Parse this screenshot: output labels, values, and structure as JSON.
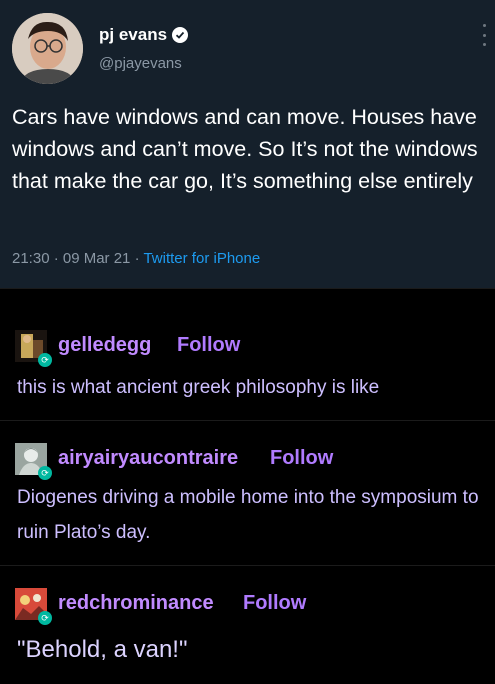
{
  "tweet": {
    "author_name": "pj evans",
    "handle": "@pjayevans",
    "text": "Cars have windows and can move. Houses have windows and can’t move. So It’s not the windows that make the car go, It’s something else entirely",
    "timestamp": "21:30 · 09 Mar 21 · ",
    "source": "Twitter for iPhone"
  },
  "reblogs": [
    {
      "username": "gelledegg",
      "follow_label": "Follow",
      "text": "this is what ancient greek philosophy is like"
    },
    {
      "username": "airyairyaucontraire",
      "follow_label": "Follow",
      "text": "Diogenes driving a mobile home into the symposium to ruin Plato’s day."
    },
    {
      "username": "redchrominance",
      "follow_label": "Follow",
      "text": "\"Behold, a van!\""
    }
  ],
  "colors": {
    "tweet_background": "#15202b",
    "page_background": "#000000",
    "username_purple": "#c18bff",
    "link_blue": "#1d9bf0",
    "reblog_badge": "#00b8a0"
  },
  "icons": [
    "verified-badge-icon",
    "more-options-icon",
    "reblog-icon"
  ]
}
